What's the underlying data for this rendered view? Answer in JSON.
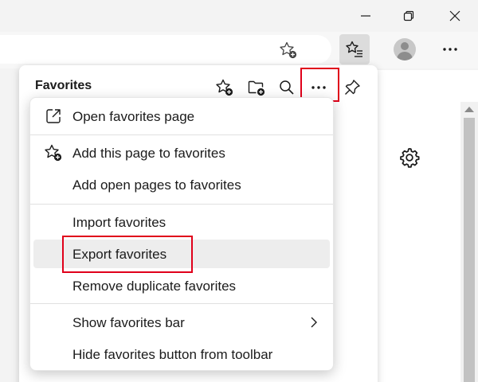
{
  "favorites_panel": {
    "title": "Favorites"
  },
  "menu": {
    "items": [
      {
        "label": "Open favorites page",
        "icon": "open-external-icon"
      },
      {
        "label": "Add this page to favorites",
        "icon": "star-add-icon"
      },
      {
        "label": "Add open pages to favorites",
        "icon": ""
      },
      {
        "label": "Import favorites",
        "icon": ""
      },
      {
        "label": "Export favorites",
        "icon": "",
        "selected": true
      },
      {
        "label": "Remove duplicate favorites",
        "icon": ""
      },
      {
        "label": "Show favorites bar",
        "icon": "chevron-right-icon"
      },
      {
        "label": "Hide favorites button from toolbar",
        "icon": ""
      }
    ]
  },
  "colors": {
    "highlight": "#e0001a",
    "selected_bg": "#ededed"
  }
}
